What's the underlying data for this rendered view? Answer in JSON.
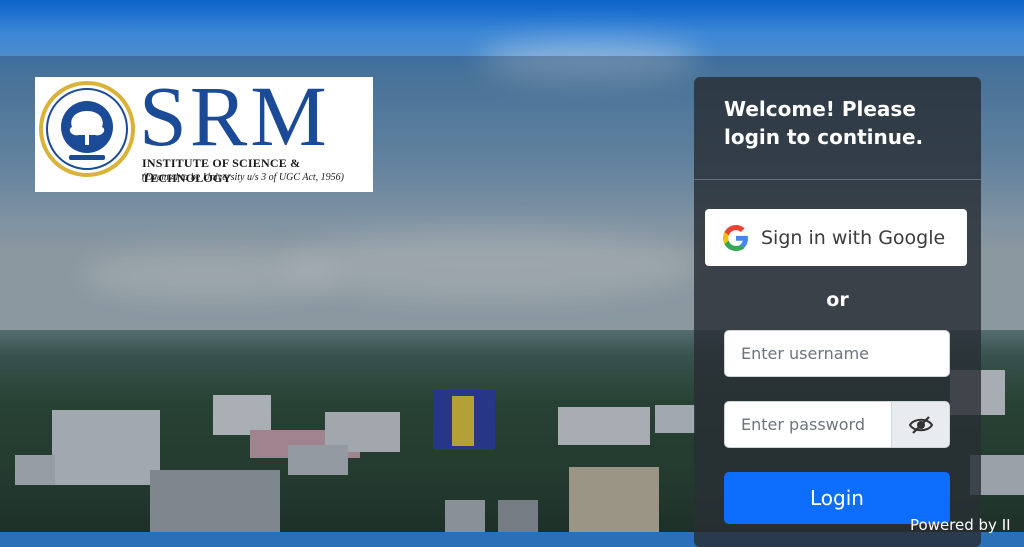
{
  "logo": {
    "brand": "SRM",
    "subtitle": "INSTITUTE OF SCIENCE & TECHNOLOGY",
    "tagline": "(Deemed to be University u/s 3 of UGC Act, 1956)"
  },
  "login": {
    "title": "Welcome! Please login to continue.",
    "google_label": "Sign in with Google",
    "or_text": "or",
    "username_placeholder": "Enter username",
    "password_placeholder": "Enter password",
    "login_label": "Login"
  },
  "footer": {
    "powered_text": "Powered by  II"
  },
  "colors": {
    "primary": "#0d6efd",
    "panel_bg": "#282e34",
    "brand_blue": "#1b4a97"
  },
  "icons": {
    "google": "google-g-icon",
    "password_toggle": "eye-slash-icon"
  }
}
